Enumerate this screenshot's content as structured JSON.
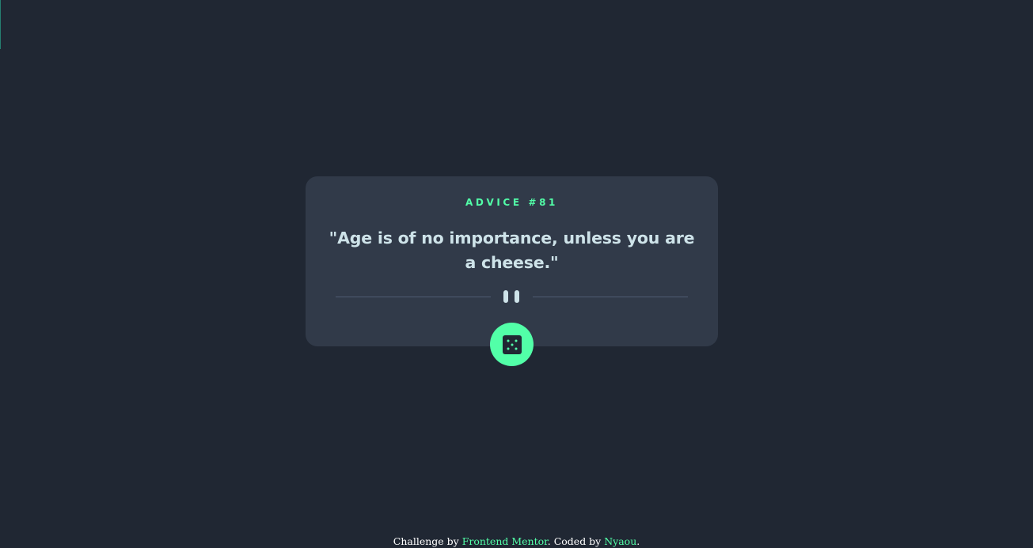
{
  "card": {
    "advice_id": "ADVICE #81",
    "advice_text": "\"Age is of no importance, unless you are a cheese.\"",
    "divider_icon": "pause-icon",
    "button_icon": "dice-icon"
  },
  "footer": {
    "prefix": "Challenge by",
    "challenge_link": "Frontend Mentor",
    "middle": ". Coded by",
    "author_link": "Nyaou",
    "suffix": "."
  },
  "colors": {
    "background": "#202733",
    "card": "#313a49",
    "accent": "#52ffa8",
    "text": "#cee3e9",
    "divider": "#4f5d74"
  }
}
